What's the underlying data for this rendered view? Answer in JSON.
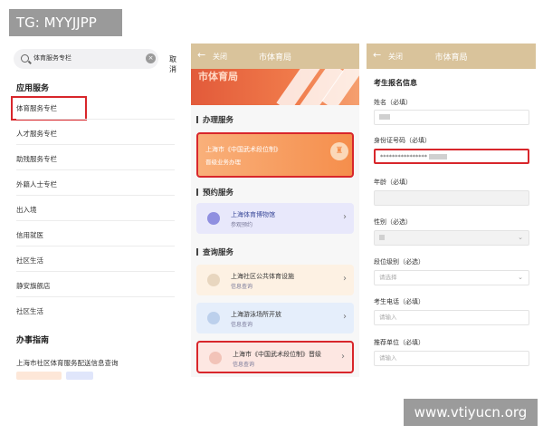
{
  "watermarks": {
    "top_left": "TG: MYYJJPP",
    "bottom_right": "www.vtiyucn.org"
  },
  "panel1": {
    "search_value": "体育服务专栏",
    "cancel_label": "取消",
    "section_apps": "应用服务",
    "items": [
      "体育服务专栏",
      "人才服务专栏",
      "助残服务专栏",
      "外籍人士专栏",
      "出入境",
      "信用就医",
      "社区生活",
      "静安旗舰店",
      "社区生活"
    ],
    "section_guide": "办事指南",
    "guide_item": "上海市社区体育服务配送信息查询"
  },
  "panel2": {
    "back_icon": "arrow-left-icon",
    "close_label": "关闭",
    "title": "市体育局",
    "banner_text": "市体育局",
    "sec_handle": "办理服务",
    "handle_card": {
      "title": "上海市《中国武术段位制》",
      "sub": "晋级业务办理"
    },
    "sec_reserve": "预约服务",
    "reserve_card": {
      "title": "上海体育博物馆",
      "sub": "参观预约"
    },
    "sec_query": "查询服务",
    "query_cards": [
      {
        "title": "上海社区公共体育设施",
        "sub": "信息查询"
      },
      {
        "title": "上海游泳场所开放",
        "sub": "信息查询"
      },
      {
        "title": "上海市《中国武术段位制》晋级",
        "sub": "信息查询"
      }
    ],
    "colors": {
      "header": "#d9c39b",
      "highlight": "#d8262b"
    }
  },
  "panel3": {
    "close_label": "关闭",
    "title": "市体育局",
    "section": "考生报名信息",
    "fields": {
      "name": "姓名（必填）",
      "id_number": "身份证号码（必填）",
      "id_value": "****************",
      "age": "年龄（必填）",
      "gender": "性别（必选）",
      "level": "段位级别（必选）",
      "level_placeholder": "请选择",
      "phone": "考生电话（必填）",
      "phone_placeholder": "请输入",
      "unit": "推荐单位（必填）",
      "unit_placeholder": "请输入"
    }
  }
}
